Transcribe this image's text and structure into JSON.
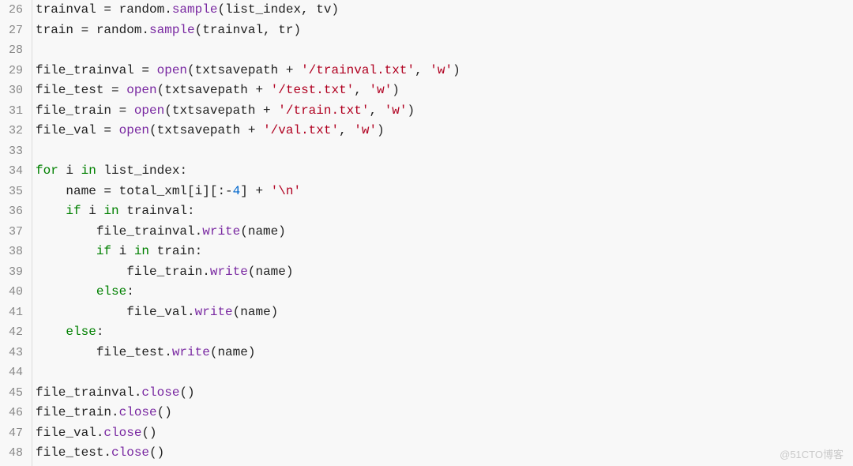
{
  "watermark": "@51CTO博客",
  "lines": [
    {
      "n": 26,
      "tokens": [
        {
          "c": "pl",
          "t": "trainval = random."
        },
        {
          "c": "fn",
          "t": "sample"
        },
        {
          "c": "pl",
          "t": "(list_index, tv)"
        }
      ]
    },
    {
      "n": 27,
      "tokens": [
        {
          "c": "pl",
          "t": "train = random."
        },
        {
          "c": "fn",
          "t": "sample"
        },
        {
          "c": "pl",
          "t": "(trainval, tr)"
        }
      ]
    },
    {
      "n": 28,
      "tokens": []
    },
    {
      "n": 29,
      "tokens": [
        {
          "c": "pl",
          "t": "file_trainval = "
        },
        {
          "c": "fn",
          "t": "open"
        },
        {
          "c": "pl",
          "t": "(txtsavepath + "
        },
        {
          "c": "str",
          "t": "'/trainval.txt'"
        },
        {
          "c": "pl",
          "t": ", "
        },
        {
          "c": "str",
          "t": "'w'"
        },
        {
          "c": "pl",
          "t": ")"
        }
      ]
    },
    {
      "n": 30,
      "tokens": [
        {
          "c": "pl",
          "t": "file_test = "
        },
        {
          "c": "fn",
          "t": "open"
        },
        {
          "c": "pl",
          "t": "(txtsavepath + "
        },
        {
          "c": "str",
          "t": "'/test.txt'"
        },
        {
          "c": "pl",
          "t": ", "
        },
        {
          "c": "str",
          "t": "'w'"
        },
        {
          "c": "pl",
          "t": ")"
        }
      ]
    },
    {
      "n": 31,
      "tokens": [
        {
          "c": "pl",
          "t": "file_train = "
        },
        {
          "c": "fn",
          "t": "open"
        },
        {
          "c": "pl",
          "t": "(txtsavepath + "
        },
        {
          "c": "str",
          "t": "'/train.txt'"
        },
        {
          "c": "pl",
          "t": ", "
        },
        {
          "c": "str",
          "t": "'w'"
        },
        {
          "c": "pl",
          "t": ")"
        }
      ]
    },
    {
      "n": 32,
      "tokens": [
        {
          "c": "pl",
          "t": "file_val = "
        },
        {
          "c": "fn",
          "t": "open"
        },
        {
          "c": "pl",
          "t": "(txtsavepath + "
        },
        {
          "c": "str",
          "t": "'/val.txt'"
        },
        {
          "c": "pl",
          "t": ", "
        },
        {
          "c": "str",
          "t": "'w'"
        },
        {
          "c": "pl",
          "t": ")"
        }
      ]
    },
    {
      "n": 33,
      "tokens": []
    },
    {
      "n": 34,
      "tokens": [
        {
          "c": "kw",
          "t": "for"
        },
        {
          "c": "pl",
          "t": " i "
        },
        {
          "c": "kw",
          "t": "in"
        },
        {
          "c": "pl",
          "t": " list_index:"
        }
      ]
    },
    {
      "n": 35,
      "tokens": [
        {
          "c": "pl",
          "t": "    name = total_xml[i][:-"
        },
        {
          "c": "num",
          "t": "4"
        },
        {
          "c": "pl",
          "t": "] + "
        },
        {
          "c": "str",
          "t": "'\\n'"
        }
      ]
    },
    {
      "n": 36,
      "tokens": [
        {
          "c": "pl",
          "t": "    "
        },
        {
          "c": "kw",
          "t": "if"
        },
        {
          "c": "pl",
          "t": " i "
        },
        {
          "c": "kw",
          "t": "in"
        },
        {
          "c": "pl",
          "t": " trainval:"
        }
      ]
    },
    {
      "n": 37,
      "tokens": [
        {
          "c": "pl",
          "t": "        file_trainval."
        },
        {
          "c": "fn",
          "t": "write"
        },
        {
          "c": "pl",
          "t": "(name)"
        }
      ]
    },
    {
      "n": 38,
      "tokens": [
        {
          "c": "pl",
          "t": "        "
        },
        {
          "c": "kw",
          "t": "if"
        },
        {
          "c": "pl",
          "t": " i "
        },
        {
          "c": "kw",
          "t": "in"
        },
        {
          "c": "pl",
          "t": " train:"
        }
      ]
    },
    {
      "n": 39,
      "tokens": [
        {
          "c": "pl",
          "t": "            file_train."
        },
        {
          "c": "fn",
          "t": "write"
        },
        {
          "c": "pl",
          "t": "(name)"
        }
      ]
    },
    {
      "n": 40,
      "tokens": [
        {
          "c": "pl",
          "t": "        "
        },
        {
          "c": "kw",
          "t": "else"
        },
        {
          "c": "pl",
          "t": ":"
        }
      ]
    },
    {
      "n": 41,
      "tokens": [
        {
          "c": "pl",
          "t": "            file_val."
        },
        {
          "c": "fn",
          "t": "write"
        },
        {
          "c": "pl",
          "t": "(name)"
        }
      ]
    },
    {
      "n": 42,
      "tokens": [
        {
          "c": "pl",
          "t": "    "
        },
        {
          "c": "kw",
          "t": "else"
        },
        {
          "c": "pl",
          "t": ":"
        }
      ]
    },
    {
      "n": 43,
      "tokens": [
        {
          "c": "pl",
          "t": "        file_test."
        },
        {
          "c": "fn",
          "t": "write"
        },
        {
          "c": "pl",
          "t": "(name)"
        }
      ]
    },
    {
      "n": 44,
      "tokens": []
    },
    {
      "n": 45,
      "tokens": [
        {
          "c": "pl",
          "t": "file_trainval."
        },
        {
          "c": "fn",
          "t": "close"
        },
        {
          "c": "pl",
          "t": "()"
        }
      ]
    },
    {
      "n": 46,
      "tokens": [
        {
          "c": "pl",
          "t": "file_train."
        },
        {
          "c": "fn",
          "t": "close"
        },
        {
          "c": "pl",
          "t": "()"
        }
      ]
    },
    {
      "n": 47,
      "tokens": [
        {
          "c": "pl",
          "t": "file_val."
        },
        {
          "c": "fn",
          "t": "close"
        },
        {
          "c": "pl",
          "t": "()"
        }
      ]
    },
    {
      "n": 48,
      "tokens": [
        {
          "c": "pl",
          "t": "file_test."
        },
        {
          "c": "fn",
          "t": "close"
        },
        {
          "c": "pl",
          "t": "()"
        }
      ]
    }
  ]
}
